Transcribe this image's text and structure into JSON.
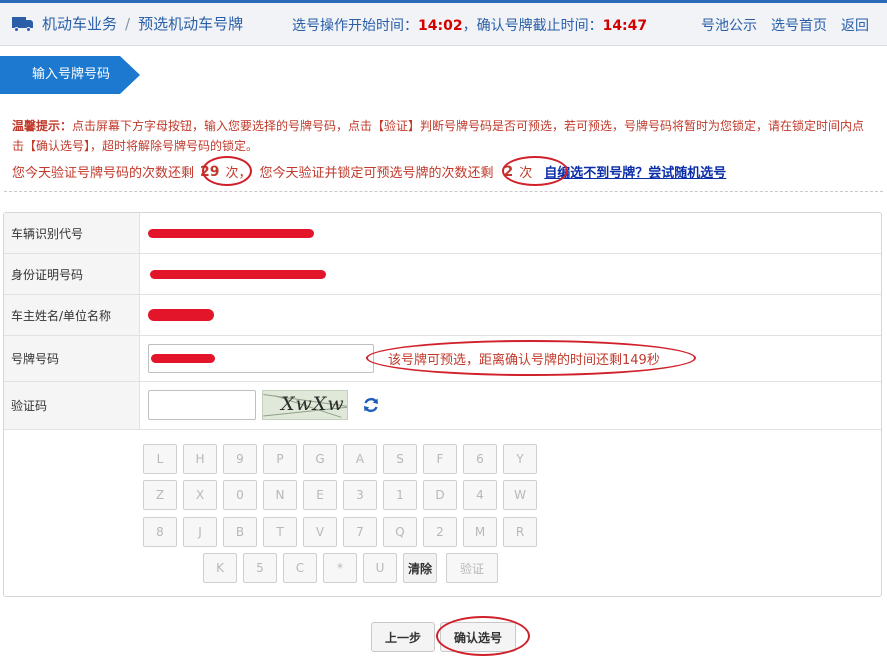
{
  "header": {
    "crumb_1": "机动车业务",
    "crumb_sep": "/",
    "crumb_2": "预选机动车号牌",
    "start_label": "选号操作开始时间：",
    "start_time": "14:02",
    "end_label": "，确认号牌截止时间：",
    "end_time": "14:47",
    "links": [
      "号池公示",
      "选号首页",
      "返回"
    ]
  },
  "step": {
    "label": "输入号牌号码"
  },
  "tip": {
    "prefix": "温馨提示：",
    "line1": "点击屏幕下方字母按钮，输入您要选择的号牌号码，点击【验证】判断号牌号码是否可预选，若可预选，号牌号码将暂时为您锁定，请在锁定时间内点",
    "line2": "击【确认选号】，超时将解除号牌号码的锁定。"
  },
  "counts": {
    "verify_prefix": "您今天验证号牌号码的次数还剩",
    "verify_count": "29",
    "verify_suffix": "次，",
    "lock_prefix": "您今天验证并锁定可预选号牌的次数还剩",
    "lock_count": "2",
    "lock_suffix": "次",
    "random_link": "自编选不到号牌？尝试随机选号"
  },
  "form": {
    "vin_label": "车辆识别代号",
    "id_label": "身份证明号码",
    "owner_label": "车主姓名/单位名称",
    "plate_label": "号牌号码",
    "plate_message": "该号牌可预选，距离确认号牌的时间还剩149秒",
    "captcha_label": "验证码",
    "captcha_text": "XwXw"
  },
  "keypad": {
    "row1": [
      "L",
      "H",
      "9",
      "P",
      "G",
      "A",
      "S",
      "F",
      "6",
      "Y"
    ],
    "row2": [
      "Z",
      "X",
      "0",
      "N",
      "E",
      "3",
      "1",
      "D",
      "4",
      "W"
    ],
    "row3": [
      "8",
      "J",
      "B",
      "T",
      "V",
      "7",
      "Q",
      "2",
      "M",
      "R"
    ],
    "row4": [
      "K",
      "5",
      "C",
      "*",
      "U"
    ],
    "clear": "清除",
    "verify": "验证"
  },
  "buttons": {
    "prev": "上一步",
    "confirm": "确认选号"
  },
  "colors": {
    "accent": "#1d78cf",
    "warning": "#c0392b",
    "time": "#d40000",
    "link": "#0b2ea8",
    "annotation": "#d0202a"
  }
}
